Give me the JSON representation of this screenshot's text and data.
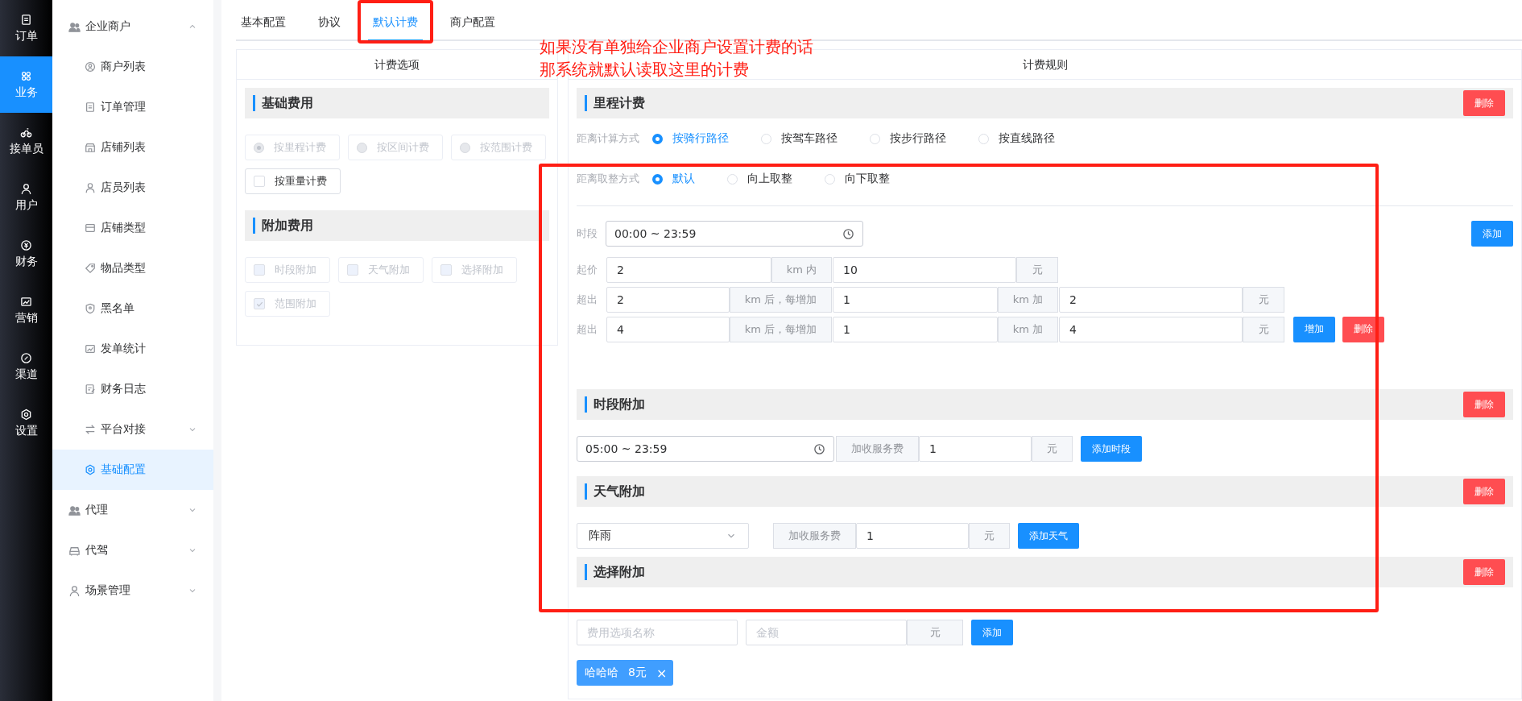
{
  "rail": [
    {
      "label": "订单",
      "selected": false
    },
    {
      "label": "业务",
      "selected": true
    },
    {
      "label": "接单员",
      "selected": false
    },
    {
      "label": "用户",
      "selected": false
    },
    {
      "label": "财务",
      "selected": false
    },
    {
      "label": "营销",
      "selected": false
    },
    {
      "label": "渠道",
      "selected": false
    },
    {
      "label": "设置",
      "selected": false
    }
  ],
  "menu": [
    {
      "label": "企业商户",
      "expanded": true,
      "children": [
        {
          "label": "商户列表",
          "selected": false
        },
        {
          "label": "订单管理",
          "selected": false
        },
        {
          "label": "店铺列表",
          "selected": false
        },
        {
          "label": "店员列表",
          "selected": false
        },
        {
          "label": "店铺类型",
          "selected": false
        },
        {
          "label": "物品类型",
          "selected": false
        },
        {
          "label": "黑名单",
          "selected": false
        },
        {
          "label": "发单统计",
          "selected": false
        },
        {
          "label": "财务日志",
          "selected": false
        },
        {
          "label": "平台对接",
          "selected": false,
          "expanded": false
        },
        {
          "label": "基础配置",
          "selected": true
        }
      ]
    },
    {
      "label": "代理",
      "expanded": false
    },
    {
      "label": "代驾",
      "expanded": false
    },
    {
      "label": "场景管理",
      "expanded": false
    }
  ],
  "tabs": [
    {
      "label": "基本配置",
      "selected": false
    },
    {
      "label": "协议",
      "selected": false
    },
    {
      "label": "默认计费",
      "selected": true
    },
    {
      "label": "商户配置",
      "selected": false
    }
  ],
  "options_panel": {
    "title": "计费选项",
    "sections": [
      {
        "title": "基础费用",
        "options": [
          {
            "kind": "radio",
            "label": "按里程计费",
            "checked": true,
            "disabled": true
          },
          {
            "kind": "radio",
            "label": "按区间计费",
            "checked": false,
            "disabled": true
          },
          {
            "kind": "radio",
            "label": "按范围计费",
            "checked": false,
            "disabled": true
          },
          {
            "kind": "checkbox",
            "label": "按重量计费",
            "checked": false,
            "disabled": false
          }
        ]
      },
      {
        "title": "附加费用",
        "options": [
          {
            "kind": "checkbox",
            "label": "时段附加",
            "checked": false,
            "disabled": true
          },
          {
            "kind": "checkbox",
            "label": "天气附加",
            "checked": false,
            "disabled": true
          },
          {
            "kind": "checkbox",
            "label": "选择附加",
            "checked": false,
            "disabled": true
          },
          {
            "kind": "checkbox",
            "label": "范围附加",
            "checked": true,
            "disabled": true
          }
        ]
      }
    ]
  },
  "rules_panel": {
    "title": "计费规则",
    "mileage": {
      "title": "里程计费",
      "delete_button": "删除",
      "distance_method": {
        "label": "距离计算方式",
        "options": [
          {
            "label": "按骑行路径",
            "selected": true
          },
          {
            "label": "按驾车路径",
            "selected": false
          },
          {
            "label": "按步行路径",
            "selected": false
          },
          {
            "label": "按直线路径",
            "selected": false
          }
        ]
      },
      "rounding": {
        "label": "距离取整方式",
        "options": [
          {
            "label": "默认",
            "selected": true
          },
          {
            "label": "向上取整",
            "selected": false
          },
          {
            "label": "向下取整",
            "selected": false
          }
        ]
      },
      "period": {
        "label": "时段",
        "value": "00:00 ~ 23:59"
      },
      "add_button": "添加",
      "rows": [
        {
          "label": "起价",
          "groups": [
            {
              "value": "2",
              "unit": "km 内"
            },
            {
              "value": "10",
              "unit": "元"
            }
          ]
        },
        {
          "label": "超出",
          "groups": [
            {
              "value": "2",
              "unit": "km 后，每增加"
            },
            {
              "value": "1",
              "unit": "km 加"
            },
            {
              "value": "2",
              "unit": "元"
            }
          ]
        },
        {
          "label": "超出",
          "groups": [
            {
              "value": "4",
              "unit": "km 后，每增加"
            },
            {
              "value": "1",
              "unit": "km 加"
            },
            {
              "value": "4",
              "unit": "元"
            }
          ],
          "buttons": [
            {
              "kind": "primary",
              "label": "增加"
            },
            {
              "kind": "danger",
              "label": "删除"
            }
          ]
        }
      ]
    },
    "time_surcharge": {
      "title": "时段附加",
      "delete_button": "删除",
      "period": "05:00 ~ 23:59",
      "fee_label": "加收服务费",
      "value": "1",
      "unit": "元",
      "add_button": "添加时段"
    },
    "weather_surcharge": {
      "title": "天气附加",
      "delete_button": "删除",
      "weather": "阵雨",
      "fee_label": "加收服务费",
      "value": "1",
      "unit": "元",
      "add_button": "添加天气"
    },
    "choice_surcharge": {
      "title": "选择附加",
      "delete_button": "删除",
      "name_placeholder": "费用选项名称",
      "amount_placeholder": "金额",
      "unit": "元",
      "add_button": "添加",
      "tags": [
        {
          "label": "哈哈哈",
          "amount": "8元",
          "close": "×"
        }
      ]
    }
  },
  "annotation": {
    "lines": [
      "如果没有单独给企业商户设置计费的话",
      "那系统就默认读取这里的计费"
    ]
  }
}
